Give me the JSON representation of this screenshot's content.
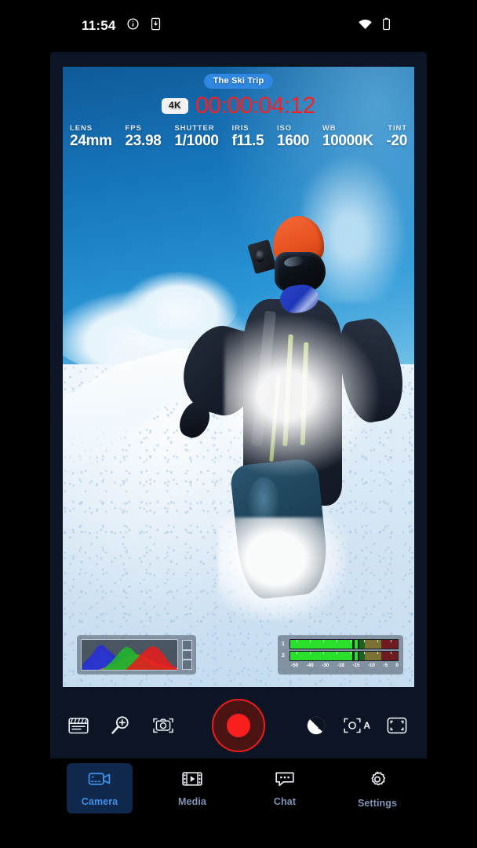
{
  "status_bar": {
    "time": "11:54",
    "icons": [
      "info-circle-icon",
      "phone-download-icon",
      "wifi-icon",
      "battery-icon"
    ]
  },
  "camera": {
    "project_badge": "The Ski Trip",
    "resolution_badge": "4K",
    "timecode": "00:00:04:12",
    "timecode_color": "#ff1f1f",
    "accent_color": "#2f87e0",
    "params": [
      {
        "label": "LENS",
        "value": "24mm"
      },
      {
        "label": "FPS",
        "value": "23.98"
      },
      {
        "label": "SHUTTER",
        "value": "1/1000"
      },
      {
        "label": "IRIS",
        "value": "f11.5"
      },
      {
        "label": "ISO",
        "value": "1600"
      },
      {
        "label": "WB",
        "value": "10000K"
      },
      {
        "label": "TINT",
        "value": "-20"
      }
    ],
    "histogram": {
      "name": "rgb-histogram",
      "channels": [
        "red",
        "green",
        "blue"
      ]
    },
    "audio_meters": {
      "channels": [
        "1",
        "2"
      ],
      "scale": [
        "-50",
        "-40",
        "-30",
        "-18",
        "-15",
        "-10",
        "-5",
        "0"
      ],
      "level_db": -20
    }
  },
  "controls": {
    "left": [
      {
        "name": "slate-icon",
        "label": "Slate"
      },
      {
        "name": "zoom-in-icon",
        "label": "Zoom"
      },
      {
        "name": "camera-focus-icon",
        "label": "Focus"
      }
    ],
    "record": {
      "name": "record-button",
      "label": "Record",
      "color": "#fa1f1f"
    },
    "right": [
      {
        "name": "exposure-compensation-icon",
        "label": "Exposure"
      },
      {
        "name": "autofocus-icon",
        "label": "Autofocus",
        "badge": "A"
      },
      {
        "name": "framing-guide-icon",
        "label": "Framing"
      }
    ]
  },
  "nav": {
    "items": [
      {
        "label": "Camera",
        "icon": "video-camera-icon",
        "active": true
      },
      {
        "label": "Media",
        "icon": "film-play-icon",
        "active": false
      },
      {
        "label": "Chat",
        "icon": "chat-bubble-icon",
        "active": false
      },
      {
        "label": "Settings",
        "icon": "gear-icon",
        "active": false
      }
    ]
  }
}
